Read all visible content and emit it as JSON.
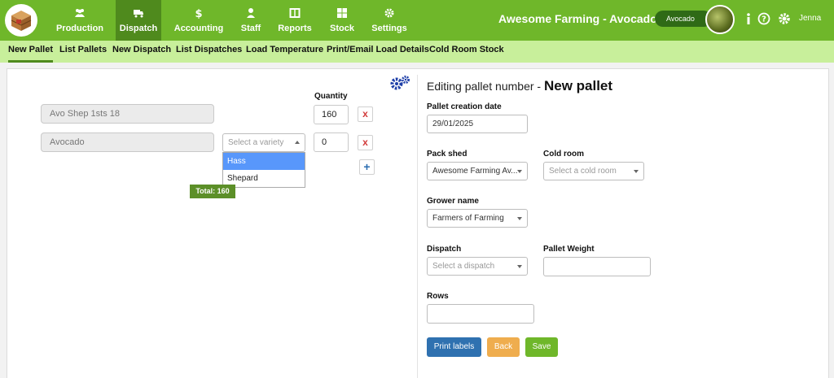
{
  "nav": {
    "items": [
      {
        "label": "Production",
        "icon": "users-icon"
      },
      {
        "label": "Dispatch",
        "icon": "truck-icon"
      },
      {
        "label": "Accounting",
        "icon": "dollar-icon"
      },
      {
        "label": "Staff",
        "icon": "person-icon"
      },
      {
        "label": "Reports",
        "icon": "report-icon"
      },
      {
        "label": "Stock",
        "icon": "grid-icon"
      },
      {
        "label": "Settings",
        "icon": "gear-icon"
      }
    ],
    "active": "Dispatch",
    "brand": "Awesome Farming - Avocados",
    "crop": "Avocado",
    "user": "Jenna"
  },
  "subnav": {
    "items": [
      "New Pallet",
      "List Pallets",
      "New Dispatch",
      "List Dispatches",
      "Load Temperature",
      "Print/Email Load Details",
      "Cold Room Stock"
    ],
    "active": "New Pallet"
  },
  "left": {
    "quantity_label": "Quantity",
    "rows": [
      {
        "product": "Avo Shep 1sts 18",
        "quantity": "160"
      },
      {
        "product": "Avocado",
        "quantity": "0"
      }
    ],
    "variety_placeholder": "Select a variety",
    "variety_options": [
      "Hass",
      "Shepard"
    ],
    "variety_highlighted": "Hass",
    "total": "Total: 160",
    "remove_label": "x",
    "add_label": "+"
  },
  "form": {
    "title_prefix": "Editing pallet number - ",
    "title_value": "New pallet",
    "pallet_creation_date_label": "Pallet creation date",
    "pallet_creation_date": "29/01/2025",
    "pack_shed_label": "Pack shed",
    "pack_shed_value": "Awesome Farming Av...",
    "cold_room_label": "Cold room",
    "cold_room_placeholder": "Select a cold room",
    "grower_name_label": "Grower name",
    "grower_name_value": "Farmers of Farming",
    "dispatch_label": "Dispatch",
    "dispatch_placeholder": "Select a dispatch",
    "pallet_weight_label": "Pallet Weight",
    "pallet_weight_value": "",
    "rows_label": "Rows",
    "rows_value": ""
  },
  "buttons": {
    "print": "Print labels",
    "back": "Back",
    "save": "Save"
  },
  "colors": {
    "nav_green": "#6fb72a",
    "nav_active": "#4f8a1d",
    "subnav": "#c8ef9b",
    "print": "#2f71b0",
    "back": "#efad4e",
    "save": "#6fb72a"
  }
}
